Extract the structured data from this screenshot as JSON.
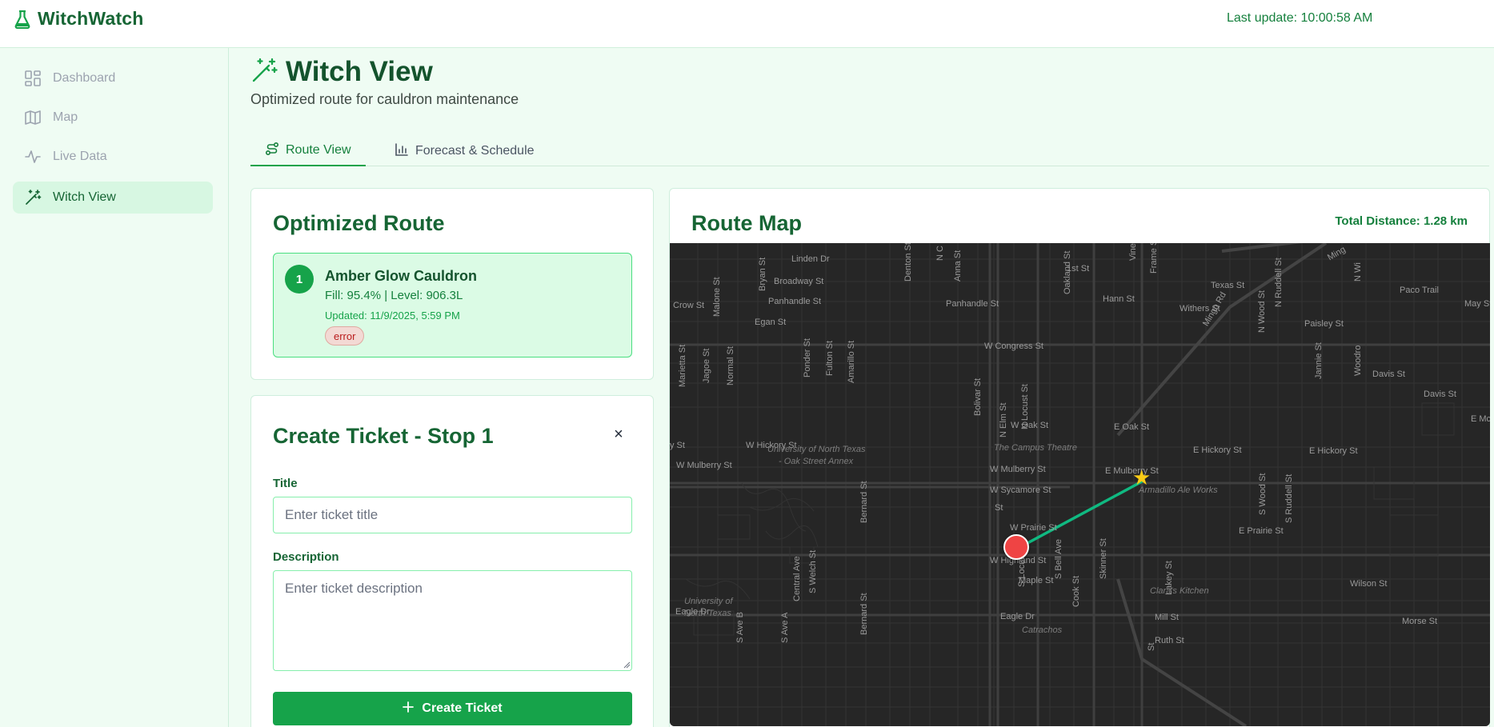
{
  "app": {
    "name": "WitchWatch",
    "last_update": "Last update: 10:00:58 AM"
  },
  "sidebar": {
    "items": [
      {
        "label": "Dashboard",
        "icon": "dashboard-icon",
        "active": false
      },
      {
        "label": "Map",
        "icon": "map-icon",
        "active": false
      },
      {
        "label": "Live Data",
        "icon": "activity-icon",
        "active": false
      },
      {
        "label": "Witch View",
        "icon": "wand-icon",
        "active": true
      }
    ]
  },
  "page": {
    "title": "Witch View",
    "subtitle": "Optimized route for cauldron maintenance",
    "icon": "wand-sparkles-icon"
  },
  "tabs": [
    {
      "label": "Route View",
      "icon": "route-icon",
      "active": true
    },
    {
      "label": "Forecast & Schedule",
      "icon": "bar-chart-icon",
      "active": false
    }
  ],
  "route": {
    "title": "Optimized Route",
    "stops": [
      {
        "number": "1",
        "name": "Amber Glow Cauldron",
        "fill_line": "Fill: 95.4% | Level: 906.3L",
        "updated": "Updated: 11/9/2025, 5:59 PM",
        "badge": "error"
      }
    ]
  },
  "ticket": {
    "title": "Create Ticket - Stop 1",
    "close_label": "×",
    "title_label": "Title",
    "title_placeholder": "Enter ticket title",
    "title_value": "",
    "description_label": "Description",
    "description_placeholder": "Enter ticket description",
    "description_value": "",
    "submit_label": "Create Ticket"
  },
  "route_map": {
    "title": "Route Map",
    "total_distance": "Total Distance: 1.28 km",
    "streets": {
      "linden": "Linden Dr",
      "broadway": "Broadway St",
      "first": "1st St",
      "texas": "Texas St",
      "paco": "Paco Trail",
      "crow": "Crow St",
      "panhandle_w": "Panhandle St",
      "panhandle_e": "Panhandle St",
      "hann": "Hann St",
      "withers": "Withers St",
      "mays": "May St",
      "egan": "Egan St",
      "paisley": "Paisley St",
      "congress": "W Congress St",
      "davis1": "Davis St",
      "davis2": "Davis St",
      "w_oak": "W Oak St",
      "e_oak": "E Oak St",
      "w_hickory1": "W Hickory St",
      "e_hickory1": "E Hickory St",
      "e_hickory2": "E Hickory St",
      "e_mc": "E Mc",
      "w_mulberry1": "W Mulberry St",
      "w_mulberry2": "W Mulberry St",
      "e_mulberry": "E Mulberry St",
      "w_sycamore": "W Sycamore St",
      "sycamore_short": "St",
      "w_prairie": "W Prairie St",
      "e_prairie": "E Prairie St",
      "w_highland": "W Highland St",
      "maple": "Maple St",
      "wilson": "Wilson St",
      "eagle_w": "Eagle Dr",
      "eagle_e": "Eagle Dr",
      "mill": "Mill St",
      "morse": "Morse St",
      "ruth": "Ruth St",
      "y_st": "y St",
      "bryan": "Bryan St",
      "malone": "Malone St",
      "denton": "Denton St",
      "n_c": "N C",
      "anna": "Anna St",
      "oakland": "Oakland St",
      "vine": "Vine St",
      "frame": "Frame St",
      "mingo": "Mingo Rd",
      "ming2": "Ming",
      "n_ruddell": "N Ruddell St",
      "n_wood": "N Wood St",
      "jannie": "Jannie St",
      "woodrow": "Woodro",
      "n_wi": "N Wi",
      "marietta": "Marietta St",
      "jagoe": "Jagoe St",
      "normal": "Normal St",
      "ponder": "Ponder St",
      "fulton": "Fulton St",
      "amarillo": "Amarillo St",
      "bolivar": "Bolivar St",
      "n_elm": "N Elm St",
      "n_locust": "N Locust St",
      "bernard1": "Bernard St",
      "bernard2": "Bernard St",
      "central": "Central Ave",
      "s_welch": "S Welch St",
      "s_ave_b": "S Ave B",
      "s_ave_a": "S Ave A",
      "s_locust": "S Locust St",
      "s_bell": "S Bell Ave",
      "skinner": "Skinner St",
      "cook": "Cook St",
      "lakey": "Lakey St",
      "s_wood": "S Wood St",
      "s_ruddell": "S Ruddell St",
      "s_st": "St"
    },
    "pois": {
      "unt1": "University of North Texas",
      "unt2": "- Oak Street Annex",
      "campus_theatre": "The Campus Theatre",
      "armadillo": "Armadillo Ale Works",
      "unt3": "University of",
      "unt4": "North Texas",
      "claras": "Clara's Kitchen",
      "catrachos": "Catrachos"
    }
  }
}
